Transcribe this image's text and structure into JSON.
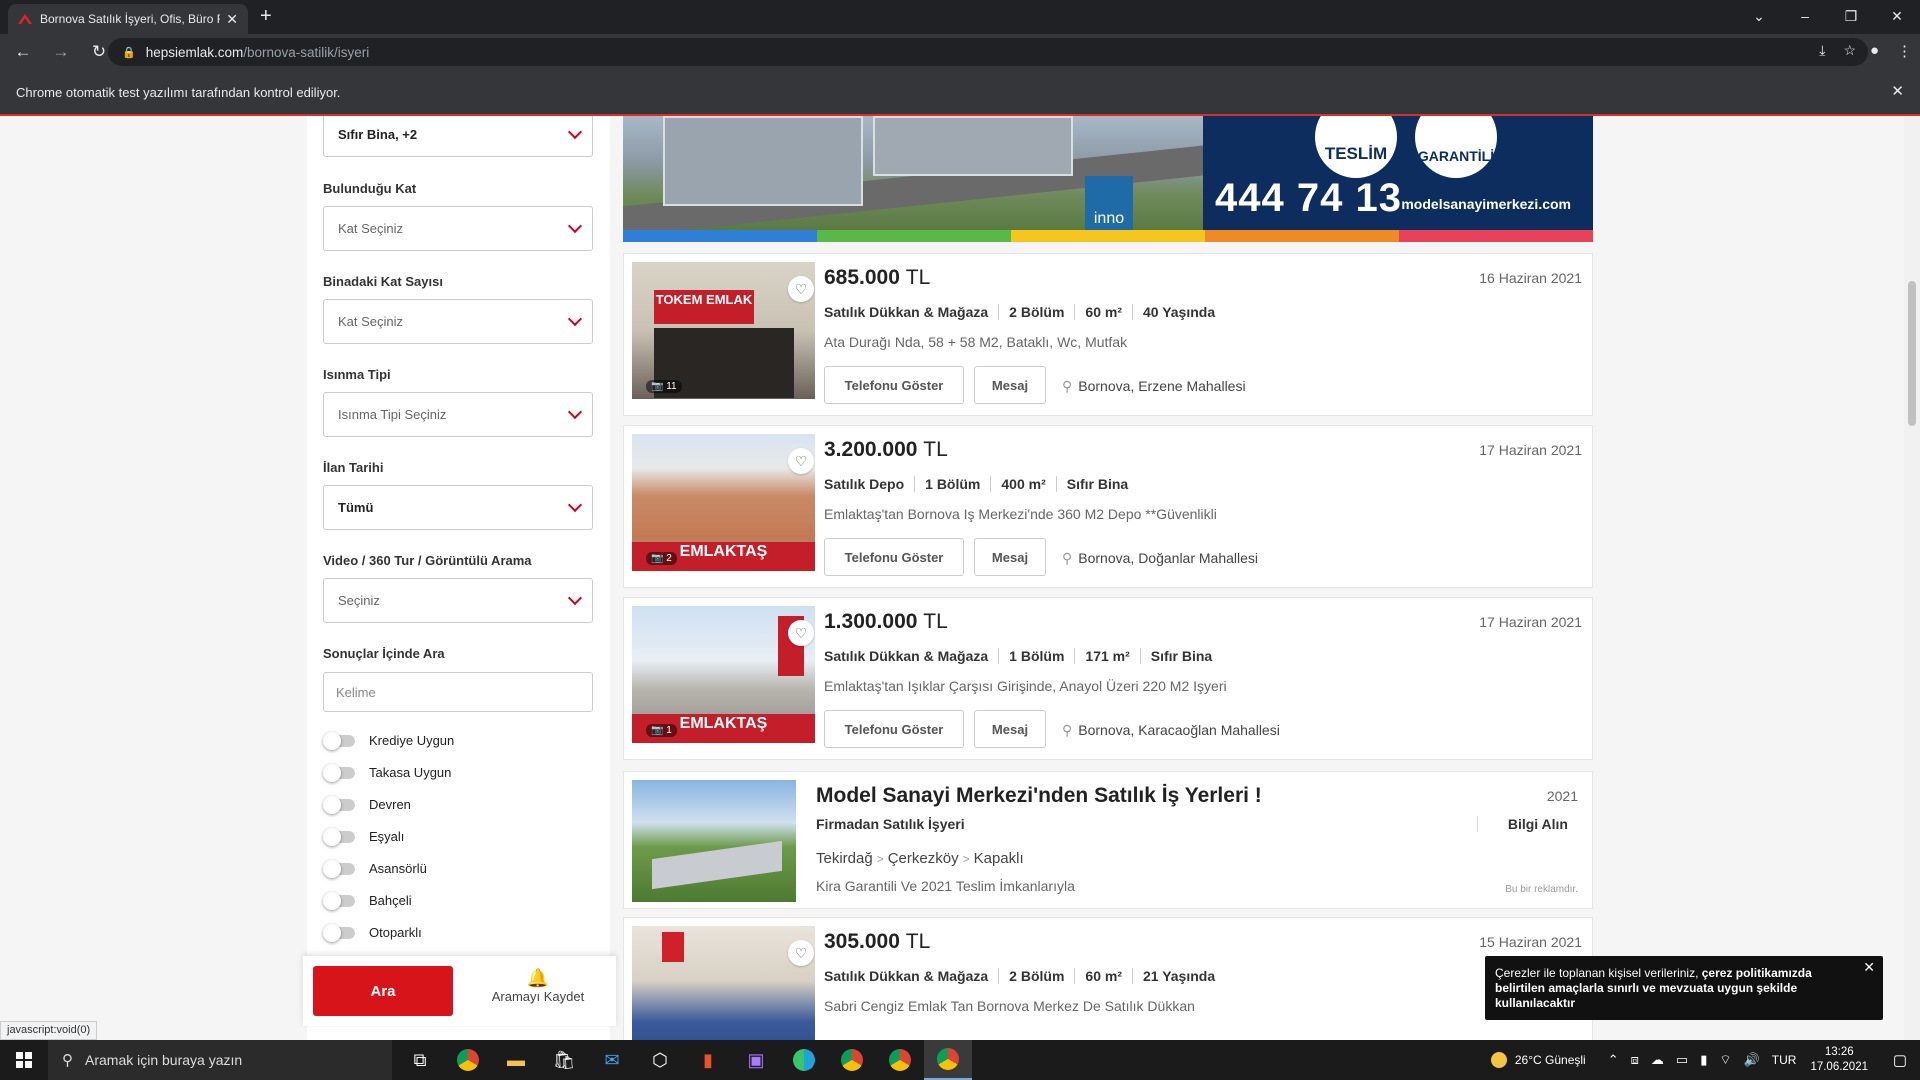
{
  "browser": {
    "tab_title": "Bornova Satılık İşyeri, Ofis, Büro F",
    "url_domain": "hepsiemlak.com",
    "url_path": "/bornova-satilik/isyeri",
    "infobar_text": "Chrome otomatik test yazılımı tarafından kontrol ediliyor.",
    "status_url": "javascript:void(0)"
  },
  "sidebar": {
    "top_select_value": "Sıfır Bina, +2",
    "filters": [
      {
        "label": "Bulunduğu Kat",
        "value": "Kat Seçiniz"
      },
      {
        "label": "Binadaki Kat Sayısı",
        "value": "Kat Seçiniz"
      },
      {
        "label": "Isınma Tipi",
        "value": "Isınma Tipi Seçiniz"
      },
      {
        "label": "İlan Tarihi",
        "value": "Tümü"
      },
      {
        "label": "Video / 360 Tur / Görüntülü Arama",
        "value": "Seçiniz"
      }
    ],
    "search_label": "Sonuçlar İçinde Ara",
    "search_placeholder": "Kelime",
    "toggles": [
      "Krediye Uygun",
      "Takasa Uygun",
      "Devren",
      "Eşyalı",
      "Asansörlü",
      "Bahçeli",
      "Otoparklı"
    ],
    "search_button": "Ara",
    "save_search": "Aramayı Kaydet"
  },
  "banner": {
    "logo_text": "inno",
    "badge1": "TESLİM",
    "badge2": "GARANTİLİ",
    "phone": "444 74 13",
    "site": "modelsanayimerkezi.com",
    "stripe_colors": [
      "#2f7fd6",
      "#59b847",
      "#f4c61e",
      "#f08a24",
      "#e8425a"
    ]
  },
  "listings": [
    {
      "price": "685.000",
      "currency": "TL",
      "date": "16 Haziran 2021",
      "specs": [
        "Satılık Dükkan & Mağaza",
        "2 Bölüm",
        "60 m²",
        "40 Yaşında"
      ],
      "desc": "Ata Durağı Nda, 58 + 58 M2, Bataklı, Wc, Mutfak",
      "photo_count": "11",
      "photo_label": "TOKEM EMLAK",
      "location": "Bornova, Erzene Mahallesi"
    },
    {
      "price": "3.200.000",
      "currency": "TL",
      "date": "17 Haziran 2021",
      "specs": [
        "Satılık Depo",
        "1 Bölüm",
        "400 m²",
        "Sıfır Bina"
      ],
      "desc": "Emlaktaş'tan Bornova Iş Merkezi'nde 360 M2 Depo **Güvenlikli",
      "photo_count": "2",
      "photo_label": "EMLAKTAŞ",
      "location": "Bornova, Doğanlar Mahallesi"
    },
    {
      "price": "1.300.000",
      "currency": "TL",
      "date": "17 Haziran 2021",
      "specs": [
        "Satılık Dükkan & Mağaza",
        "1 Bölüm",
        "171 m²",
        "Sıfır Bina"
      ],
      "desc": "Emlaktaş'tan Işıklar Çarşısı Girişinde, Anayol Üzeri 220 M2 Işyeri",
      "photo_count": "1",
      "photo_label": "EMLAKTAŞ",
      "location": "Bornova, Karacaoğlan Mahallesi"
    },
    {
      "price": "305.000",
      "currency": "TL",
      "date": "15 Haziran 2021",
      "specs": [
        "Satılık Dükkan & Mağaza",
        "2 Bölüm",
        "60 m²",
        "21 Yaşında"
      ],
      "desc": "Sabri Cengiz Emlak Tan Bornova Merkez De Satılık Dükkan",
      "photo_count": "",
      "photo_label": "",
      "location": ""
    }
  ],
  "buttons": {
    "phone": "Telefonu Göster",
    "message": "Mesaj"
  },
  "ad": {
    "title": "Model Sanayi Merkezi'nden Satılık İş Yerleri !",
    "year": "2021",
    "firm": "Firmadan Satılık İşyeri",
    "cta": "Bilgi Alın",
    "loc": [
      "Tekirdağ",
      "Çerkezköy",
      "Kapaklı"
    ],
    "sub": "Kira Garantili Ve 2021 Teslim İmkanlarıyla",
    "note": "Bu bir reklamdır."
  },
  "cookie": {
    "pre": "Çerezler ile toplanan kişisel verileriniz, ",
    "bold": "çerez politikamızda",
    "post": " belirtilen amaçlarla sınırlı ve mevzuata uygun şekilde kullanılacaktır"
  },
  "taskbar": {
    "search_placeholder": "Aramak için buraya yazın",
    "weather": "26°C Güneşli",
    "lang": "TUR",
    "time": "13:26",
    "date": "17.06.2021"
  }
}
